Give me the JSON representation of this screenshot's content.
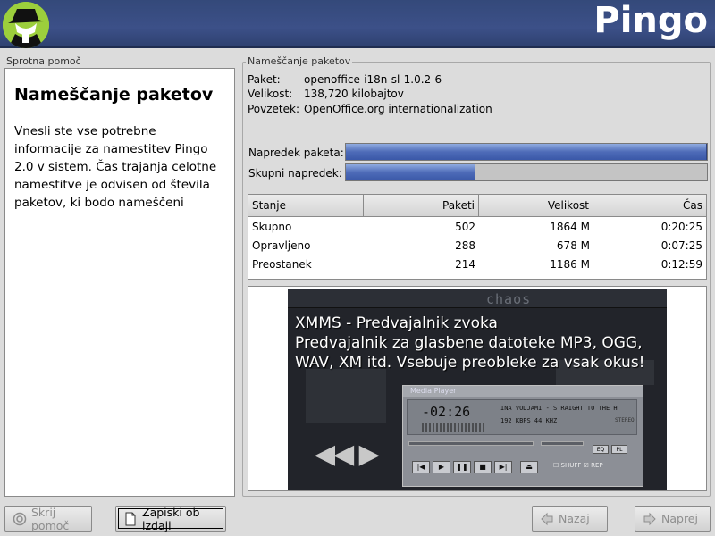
{
  "header": {
    "title": "Pingo",
    "logo_icon": "shadowman-logo-icon"
  },
  "help": {
    "section_label": "Sprotna pomoč",
    "title": "Nameščanje paketov",
    "text": "Vnesli ste vse potrebne informacije za namestitev Pingo 2.0 v sistem. Čas trajanja celotne namestitve je odvisen od števila paketov, ki bodo nameščeni"
  },
  "install": {
    "section_label": "Nameščanje paketov",
    "package_key": "Paket:",
    "package_value": "openoffice-i18n-sl-1.0.2-6",
    "size_key": "Velikost:",
    "size_value": "138,720 kilobajtov",
    "summary_key": "Povzetek:",
    "summary_value": "OpenOffice.org internationalization",
    "progress_package_label": "Napredek paketa:",
    "progress_package_value": 1.0,
    "progress_total_label": "Skupni napredek:",
    "progress_total_value": 0.36
  },
  "table": {
    "headers": [
      "Stanje",
      "Paketi",
      "Velikost",
      "Čas"
    ],
    "rows": [
      [
        "Skupno",
        "502",
        "1864 M",
        "0:20:25"
      ],
      [
        "Opravljeno",
        "288",
        "678 M",
        "0:07:25"
      ],
      [
        "Preostanek",
        "214",
        "1186 M",
        "0:12:59"
      ]
    ]
  },
  "slide": {
    "skin_name": "chaos",
    "caption_line1": "XMMS - Predvajalnik zvoka",
    "caption_line2": "Predvajalnik za glasbene datoteke MP3, OGG,",
    "caption_line3": "WAV, XM itd. Vsebuje preobleke za vsak okus!",
    "player_title": "Media Player",
    "player_time": "-02:26",
    "player_song": "INA VODJAMI - STRAIGHT TO THE H",
    "player_kbps": "192 KBPS  44 KHZ",
    "player_stereo": "STEREO",
    "player_eq": "EQ",
    "player_pl": "PL",
    "player_shuffle": "SHUFF",
    "player_repeat": "REP"
  },
  "buttons": {
    "hide_help": "Skrij pomoč",
    "release_notes": "Zapiski ob izdaji",
    "back": "Nazaj",
    "next": "Naprej"
  },
  "colors": {
    "banner": "#34497a",
    "progress_fill": "#4e6bb8",
    "logo_green": "#9ccf3c"
  }
}
